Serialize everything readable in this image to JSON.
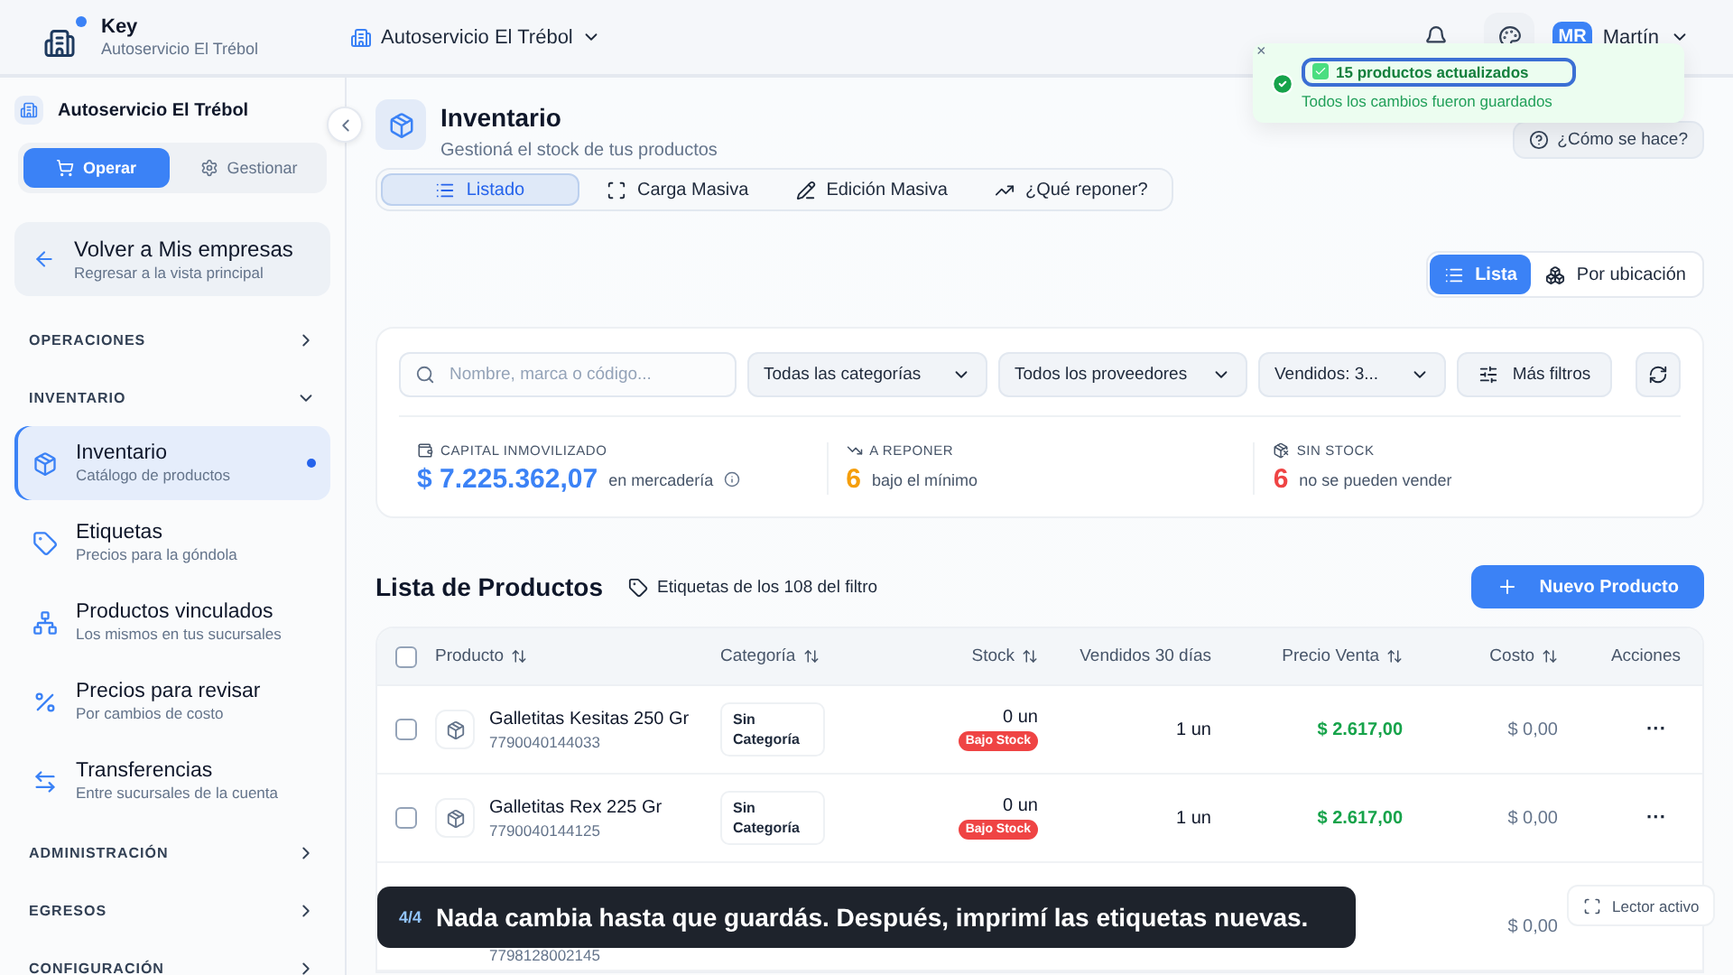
{
  "topbar": {
    "app_name": "Key",
    "app_store": "Autoservicio El Trébol",
    "store_selector": "Autoservicio El Trébol",
    "user": {
      "initials": "MR",
      "name": "Martín"
    }
  },
  "toast": {
    "title": "15 productos actualizados",
    "message": "Todos los cambios fueron guardados",
    "close": "×"
  },
  "sidebar": {
    "store": "Autoservicio El Trébol",
    "modes": [
      {
        "label": "Operar",
        "selected": true
      },
      {
        "label": "Gestionar",
        "selected": false
      }
    ],
    "back": {
      "title": "Volver a Mis empresas",
      "subtitle": "Regresar a la vista principal"
    },
    "sections": [
      {
        "label": "OPERACIONES",
        "expanded": false
      },
      {
        "label": "INVENTARIO",
        "expanded": true,
        "items": [
          {
            "kind": "box",
            "title": "Inventario",
            "subtitle": "Catálogo de productos",
            "selected": true
          },
          {
            "kind": "tag",
            "title": "Etiquetas",
            "subtitle": "Precios para la góndola",
            "selected": false
          },
          {
            "kind": "network",
            "title": "Productos vinculados",
            "subtitle": "Los mismos en tus sucursales",
            "selected": false
          },
          {
            "kind": "percent",
            "title": "Precios para revisar",
            "subtitle": "Por cambios de costo",
            "selected": false
          },
          {
            "kind": "transfer",
            "title": "Transferencias",
            "subtitle": "Entre sucursales de la cuenta",
            "selected": false
          }
        ]
      },
      {
        "label": "ADMINISTRACIÓN",
        "expanded": false
      },
      {
        "label": "EGRESOS",
        "expanded": false
      },
      {
        "label": "CONFIGURACIÓN",
        "expanded": false
      }
    ]
  },
  "page": {
    "title": "Inventario",
    "subtitle": "Gestioná el stock de tus productos",
    "help": "¿Cómo se hace?",
    "tabs": [
      {
        "kind": "list",
        "label": "Listado",
        "selected": true
      },
      {
        "kind": "scan",
        "label": "Carga Masiva",
        "selected": false
      },
      {
        "kind": "edit",
        "label": "Edición Masiva",
        "selected": false
      },
      {
        "kind": "trend",
        "label": "¿Qué reponer?",
        "selected": false
      }
    ],
    "views": [
      {
        "kind": "list",
        "label": "Lista",
        "selected": true
      },
      {
        "kind": "location",
        "label": "Por ubicación",
        "selected": false
      }
    ]
  },
  "filters": {
    "search_placeholder": "Nombre, marca o código...",
    "dropdowns": [
      "Todas las categorías",
      "Todos los proveedores",
      "Vendidos: 3..."
    ],
    "more": "Más filtros"
  },
  "stats": [
    {
      "kind": "capital",
      "label": "CAPITAL INMOVILIZADO",
      "value": "$ 7.225.362,07",
      "note": "en mercadería",
      "color": "#3b82f6"
    },
    {
      "kind": "reorder",
      "label": "A REPONER",
      "value": "6",
      "note": "bajo el mínimo",
      "color": "#f59e0b"
    },
    {
      "kind": "nostock",
      "label": "SIN STOCK",
      "value": "6",
      "note": "no se pueden vender",
      "color": "#ef4444"
    }
  ],
  "list": {
    "title": "Lista de Productos",
    "labels_link": "Etiquetas de los 108 del filtro",
    "new_button": "Nuevo Producto"
  },
  "table": {
    "select_all": {
      "checked": false
    },
    "columns": [
      {
        "label": "Producto",
        "sortable": true
      },
      {
        "label": "Categoría",
        "sortable": true
      },
      {
        "label": "Stock",
        "sortable": true
      },
      {
        "label": "Vendidos 30 días",
        "sortable": false
      },
      {
        "label": "Precio Venta",
        "sortable": true
      },
      {
        "label": "Costo",
        "sortable": true
      },
      {
        "label": "Acciones",
        "sortable": false
      }
    ],
    "rows": [
      {
        "checked": false,
        "name": "Galletitas Kesitas 250 Gr",
        "sku": "7790040144033",
        "category": "Sin Categoría",
        "stock": "0 un",
        "badge": "Bajo Stock",
        "sold": "1 un",
        "price": "$ 2.617,00",
        "cost": "$ 0,00",
        "actions": "···"
      },
      {
        "checked": false,
        "name": "Galletitas Rex 225 Gr",
        "sku": "7790040144125",
        "category": "Sin Categoría",
        "stock": "0 un",
        "badge": "Bajo Stock",
        "sold": "1 un",
        "price": "$ 2.617,00",
        "cost": "$ 0,00",
        "actions": "···"
      },
      {
        "sku": "7798128002145",
        "cost": "$ 0,00"
      }
    ]
  },
  "caption": {
    "step": "4/4",
    "text": "Nada cambia hasta que guardás. Después, imprimí las etiquetas nuevas."
  },
  "reader": {
    "label": "Lector activo"
  }
}
